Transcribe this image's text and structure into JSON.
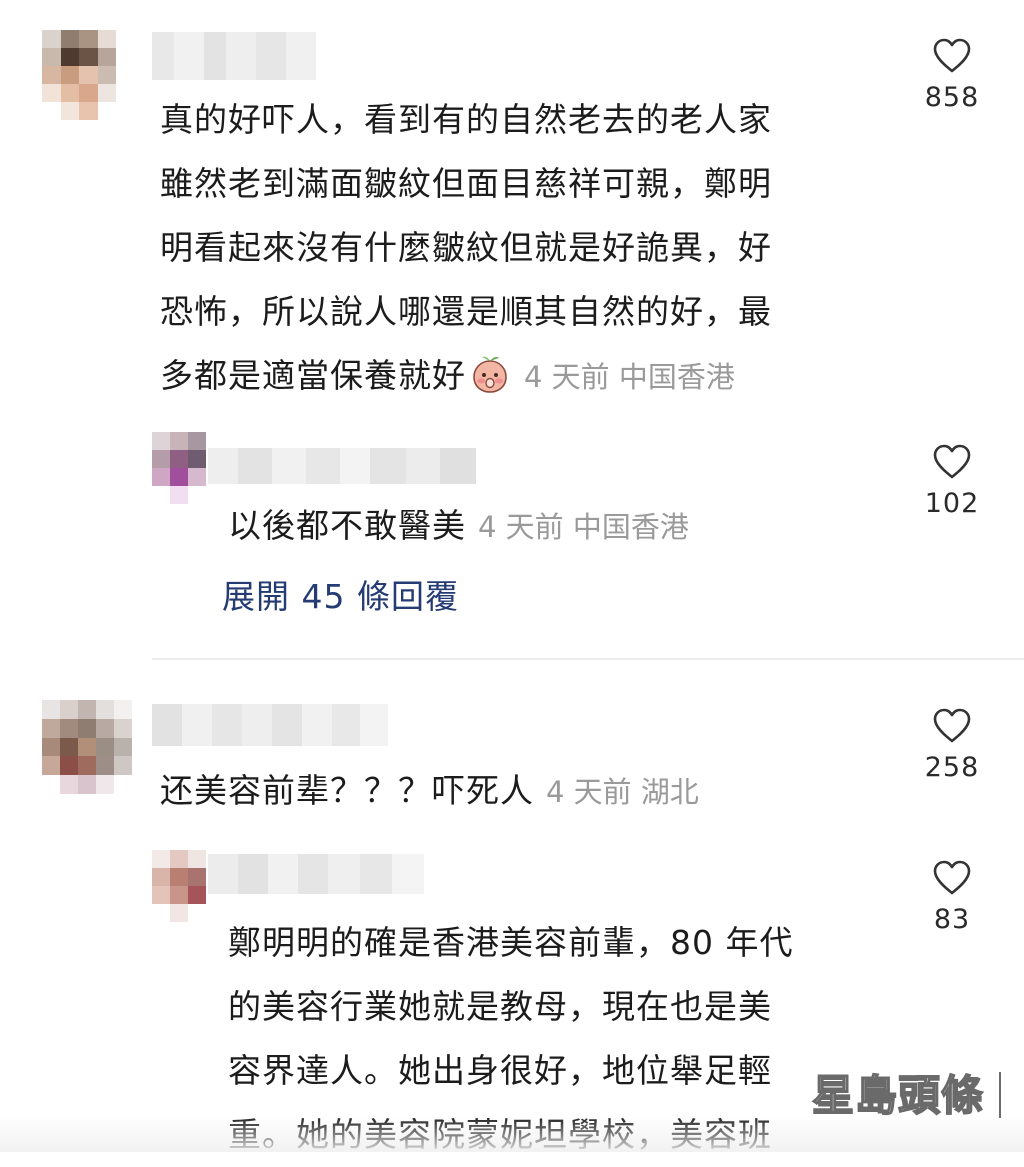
{
  "comments": [
    {
      "text_lines": [
        "真的好吓人，看到有的自然老去的老人家",
        "雖然老到滿面皺紋但面目慈祥可親，鄭明",
        "明看起來沒有什麼皺紋但就是好詭異，好",
        "恐怖，所以說人哪還是順其自然的好，最",
        "多都是適當保養就好"
      ],
      "meta": "4 天前  中国香港",
      "likes": "858",
      "emoji": "shy-peach-emoji",
      "replies": [
        {
          "text_lines": [
            "以後都不敢醫美"
          ],
          "meta": "4 天前  中国香港",
          "likes": "102"
        }
      ],
      "expand_label": "展開 45 條回覆"
    },
    {
      "text_lines": [
        "还美容前辈？？？吓死人"
      ],
      "meta": "4 天前  湖北",
      "likes": "258",
      "replies": [
        {
          "text_lines": [
            "鄭明明的確是香港美容前輩，80 年代",
            "的美容行業她就是教母，現在也是美",
            "容界達人。她出身很好，地位舉足輕",
            "重。她的美容院蒙妮坦學校，美容班"
          ],
          "likes": "83"
        }
      ]
    }
  ],
  "watermark": "星島頭條",
  "colors": {
    "link": "#243b73",
    "meta": "#9a9a9a",
    "divider": "#ececec"
  }
}
